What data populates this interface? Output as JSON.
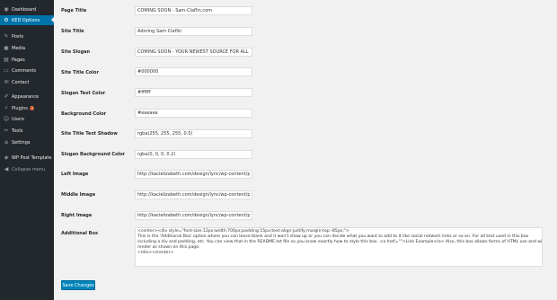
{
  "sidebar": {
    "items": [
      {
        "label": "Dashboard",
        "icon": "dashboard-icon",
        "glyph": "◉"
      },
      {
        "label": "KED Options",
        "icon": "settings-icon",
        "glyph": "⚙"
      },
      {
        "label": "Posts",
        "icon": "pin-icon",
        "glyph": "✎"
      },
      {
        "label": "Media",
        "icon": "media-icon",
        "glyph": "▣"
      },
      {
        "label": "Pages",
        "icon": "page-icon",
        "glyph": "▤"
      },
      {
        "label": "Comments",
        "icon": "comment-icon",
        "glyph": "▭"
      },
      {
        "label": "Contact",
        "icon": "mail-icon",
        "glyph": "✉"
      },
      {
        "label": "Appearance",
        "icon": "brush-icon",
        "glyph": "✐"
      },
      {
        "label": "Plugins",
        "icon": "plugin-icon",
        "glyph": "⚡",
        "badge": "3"
      },
      {
        "label": "Users",
        "icon": "users-icon",
        "glyph": "☺"
      },
      {
        "label": "Tools",
        "icon": "wrench-icon",
        "glyph": "✂"
      },
      {
        "label": "Settings",
        "icon": "sliders-icon",
        "glyph": "≡"
      },
      {
        "label": "WP Post Template",
        "icon": "template-icon",
        "glyph": "◈"
      },
      {
        "label": "Collapse menu",
        "icon": "collapse-icon",
        "glyph": "◀"
      }
    ]
  },
  "form": {
    "page_title": {
      "label": "Page Title",
      "value": "COMING SOON - Sam-Claflin.com"
    },
    "site_title": {
      "label": "Site Title",
      "value": "Adoring Sam Claflin"
    },
    "site_slogan": {
      "label": "Site Slogan",
      "value": "COMING SOON - YOUR NEWEST SOURCE FOR ALL TH"
    },
    "site_title_color": {
      "label": "Site Title Color",
      "value": "#000000"
    },
    "slogan_text_color": {
      "label": "Slogan Text Color",
      "value": "#ffffff"
    },
    "background_color": {
      "label": "Background Color",
      "value": "#eaeaea"
    },
    "site_title_text_shadow": {
      "label": "Site Title Text Shadow",
      "value": "rgba(255, 255, 255, 0.5)"
    },
    "slogan_background_color": {
      "label": "Slogan Background Color",
      "value": "rgba(0, 0, 0, 0.2)"
    },
    "left_image": {
      "label": "Left Image",
      "value": "http://kacielizabeth.com/design/lync/wp-content/plugin"
    },
    "middle_image": {
      "label": "Middle Image",
      "value": "http://kacielizabeth.com/design/lync/wp-content/plugin"
    },
    "right_image": {
      "label": "Right Image",
      "value": "http://kacielizabeth.com/design/lync/wp-content/plugin"
    },
    "additional_box": {
      "label": "Additional Box",
      "lines": [
        "<center><div style=\"font-size:12px;width:700px;padding:15px;text-align:justify;margin-top:-85px;\">",
        "This is the 'Additional Box' option where you can leave blank and it won't show up or you can decide what you want to add to it like social network links or so-on. For all text used in this box",
        "including a div and padding, etc. You can view that in the README.txt file so you know exactly how to style this box. <a href=\"\">Link Example</a> Also, this box allows forms of HTML use and will",
        "render as shown on this page.",
        "</div></center>"
      ]
    }
  },
  "save_label": "Save Changes",
  "colors": {
    "sidebar_bg": "#23282d",
    "active": "#0073aa",
    "button": "#0085ba",
    "page_bg": "#f1f1f1",
    "badge": "#d54e21"
  }
}
